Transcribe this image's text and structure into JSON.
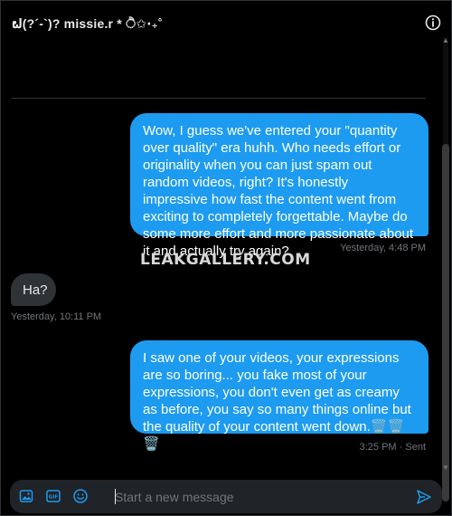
{
  "header": {
    "title": "ຝ(?´-`)? missie.r * ੈ✩‧₊˚",
    "info_icon": "info-icon"
  },
  "messages": [
    {
      "direction": "outgoing",
      "text": "Wow, I guess we've entered your \"quantity over quality\" era huhh. Who needs effort or originality when you can just spam out random videos, right? It's honestly impressive how fast the content went from exciting to completely forgettable. Maybe do some more effort and more passionate about it and actually try again?",
      "timestamp": "Yesterday, 4:48 PM"
    },
    {
      "direction": "incoming",
      "text": "Ha?",
      "timestamp": "Yesterday, 10:11 PM"
    },
    {
      "direction": "outgoing",
      "text": "I saw one of your videos, your expressions are so boring... you fake most of your expressions, you don't even get as creamy as before, you say so many things online but the quality of your content went down.🗑️🗑️🗑️",
      "timestamp": "3:25 PM · Sent"
    }
  ],
  "watermark": "LEAKGALLERY.COM",
  "composer": {
    "placeholder": "Start a new message",
    "value": "",
    "icons": [
      "image-icon",
      "gif-icon",
      "emoji-icon",
      "send-icon"
    ]
  },
  "colors": {
    "background": "#000000",
    "outgoing_bubble": "#1d9bf0",
    "incoming_bubble": "#2f3336",
    "muted_text": "#71767b",
    "accent": "#1d9bf0"
  }
}
